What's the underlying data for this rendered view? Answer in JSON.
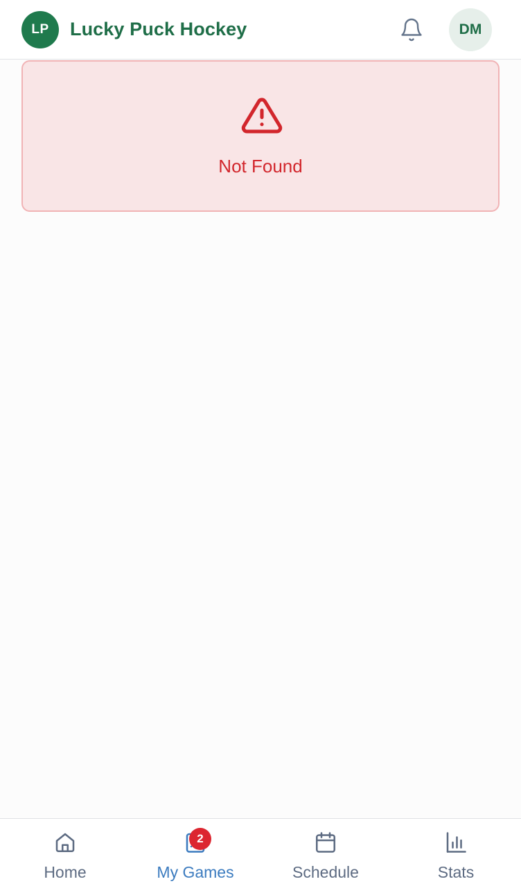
{
  "header": {
    "logo_initials": "LP",
    "app_title": "Lucky Puck Hockey",
    "user_initials": "DM"
  },
  "error": {
    "message": "Not Found"
  },
  "bottom_nav": {
    "items": [
      {
        "label": "Home",
        "icon": "home-icon"
      },
      {
        "label": "My Games",
        "icon": "my-games-icon",
        "active": true,
        "badge": "2"
      },
      {
        "label": "Schedule",
        "icon": "calendar-icon"
      },
      {
        "label": "Stats",
        "icon": "bar-chart-icon"
      }
    ]
  },
  "colors": {
    "brand_green": "#1f7a4d",
    "error_red": "#d2262c",
    "error_bg": "#f9e5e6",
    "nav_active": "#3b7bbf",
    "nav_inactive": "#5d6b82",
    "badge": "#dc2630"
  }
}
